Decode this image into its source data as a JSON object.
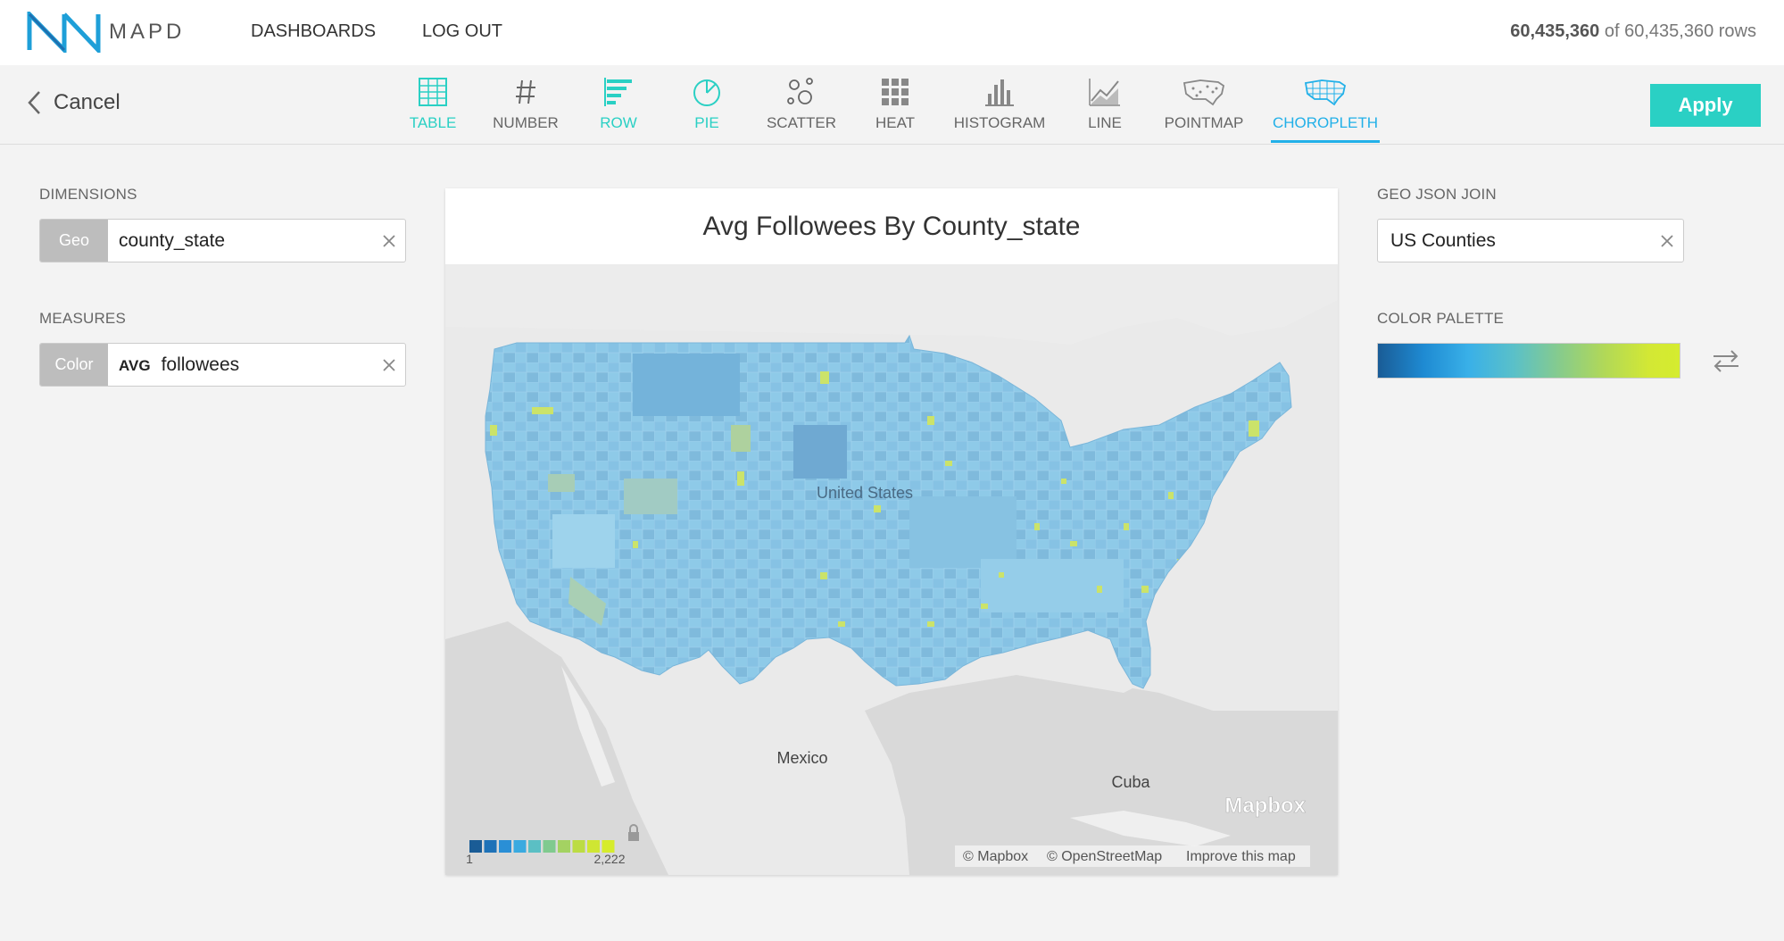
{
  "app": {
    "brand": "MAPD",
    "nav": [
      "DASHBOARDS",
      "LOG OUT"
    ],
    "row_count": {
      "shown": "60,435,360",
      "of_label": "of 60,435,360 rows"
    }
  },
  "toolbar": {
    "cancel_label": "Cancel",
    "chart_types": [
      "TABLE",
      "NUMBER",
      "ROW",
      "PIE",
      "SCATTER",
      "HEAT",
      "HISTOGRAM",
      "LINE",
      "POINTMAP",
      "CHOROPLETH"
    ],
    "active_type": "CHOROPLETH",
    "apply_label": "Apply"
  },
  "left": {
    "dimensions_label": "DIMENSIONS",
    "dimension": {
      "tag": "Geo",
      "value": "county_state"
    },
    "measures_label": "MEASURES",
    "measure": {
      "tag": "Color",
      "agg": "AVG",
      "value": "followees"
    }
  },
  "chart": {
    "title": "Avg Followees By County_state",
    "map_labels": {
      "country": "United States",
      "mexico": "Mexico",
      "cuba": "Cuba"
    },
    "legend": {
      "min": "1",
      "max": "2,222",
      "colors": [
        "#1a5c96",
        "#1e72b8",
        "#2a8fd6",
        "#3aaae0",
        "#5bbfc4",
        "#80ca8f",
        "#a4d262",
        "#bcdc44",
        "#cfe633",
        "#d6ec2c"
      ]
    },
    "attribution": {
      "mapbox": "© Mapbox",
      "osm": "© OpenStreetMap",
      "improve": "Improve this map",
      "watermark": "Mapbox"
    }
  },
  "right": {
    "geojson_label": "GEO JSON JOIN",
    "geojson_value": "US Counties",
    "palette_label": "COLOR PALETTE"
  },
  "colors": {
    "accent_teal": "#2ad0c4",
    "accent_blue": "#22b0e8",
    "map_base": "#8ecae8"
  }
}
